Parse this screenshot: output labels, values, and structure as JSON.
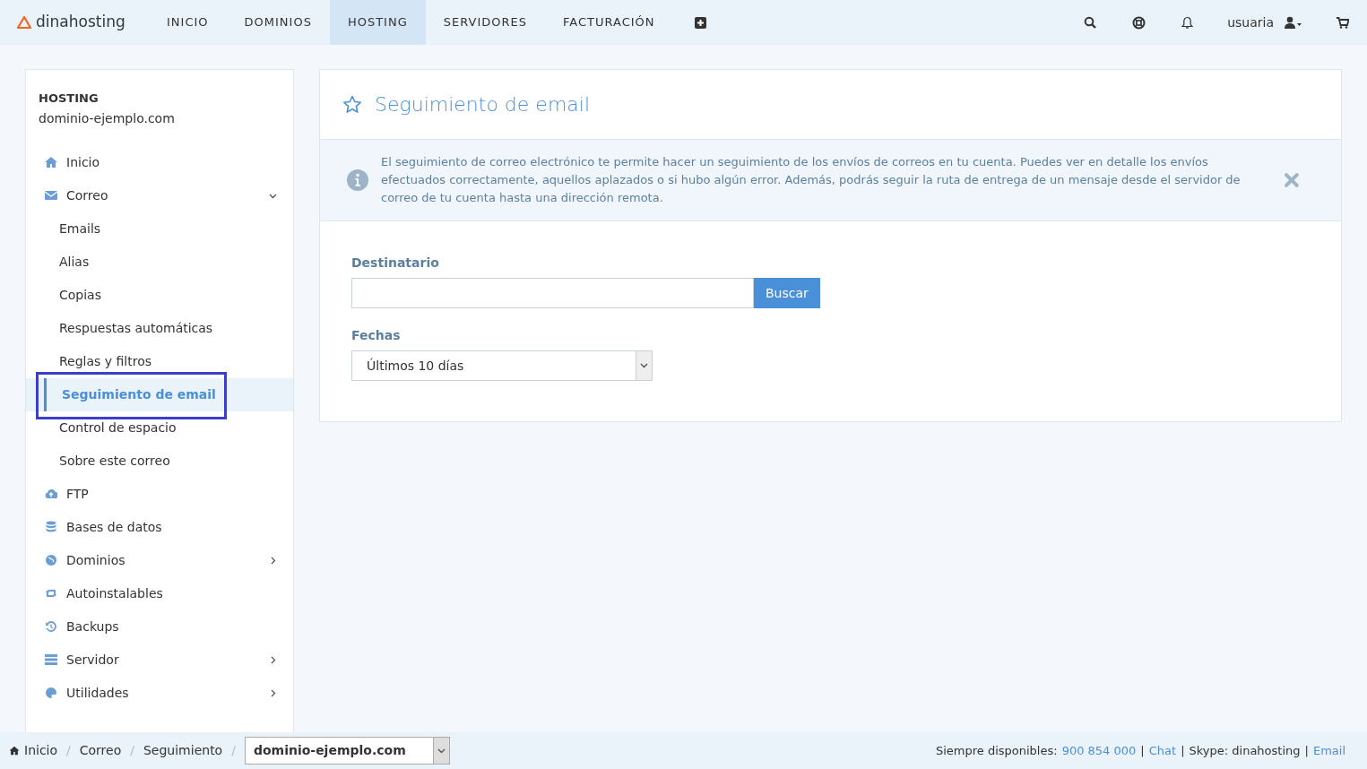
{
  "topbar": {
    "logo": "dinahosting",
    "nav": [
      {
        "label": "INICIO",
        "selected": false
      },
      {
        "label": "DOMINIOS",
        "selected": false
      },
      {
        "label": "HOSTING",
        "selected": true
      },
      {
        "label": "SERVIDORES",
        "selected": false
      },
      {
        "label": "FACTURACIÓN",
        "selected": false
      }
    ],
    "user": "usuaria"
  },
  "sidebar": {
    "section": "HOSTING",
    "domain": "dominio-ejemplo.com",
    "items": [
      {
        "kind": "main",
        "label": "Inicio",
        "selected": false
      },
      {
        "kind": "main",
        "label": "Correo",
        "selected": false,
        "expanded": true
      },
      {
        "kind": "sub",
        "label": "Emails",
        "selected": false
      },
      {
        "kind": "sub",
        "label": "Alias",
        "selected": false
      },
      {
        "kind": "sub",
        "label": "Copias",
        "selected": false
      },
      {
        "kind": "sub",
        "label": "Respuestas automáticas",
        "selected": false
      },
      {
        "kind": "sub",
        "label": "Reglas y filtros",
        "selected": false
      },
      {
        "kind": "sub",
        "label": "Seguimiento de email",
        "selected": true
      },
      {
        "kind": "sub",
        "label": "Control de espacio",
        "selected": false
      },
      {
        "kind": "sub",
        "label": "Sobre este correo",
        "selected": false
      },
      {
        "kind": "main",
        "label": "FTP",
        "selected": false
      },
      {
        "kind": "main",
        "label": "Bases de datos",
        "selected": false
      },
      {
        "kind": "main",
        "label": "Dominios",
        "selected": false,
        "expanded": false
      },
      {
        "kind": "main",
        "label": "Autoinstalables",
        "selected": false
      },
      {
        "kind": "main",
        "label": "Backups",
        "selected": false
      },
      {
        "kind": "main",
        "label": "Servidor",
        "selected": false,
        "expanded": false
      },
      {
        "kind": "main",
        "label": "Utilidades",
        "selected": false,
        "expanded": false
      }
    ]
  },
  "panel": {
    "title": "Seguimiento de email",
    "info": "El seguimiento de correo electrónico te permite hacer un seguimiento de los envíos de correos en tu cuenta. Puedes ver en detalle los envíos efectuados correctamente, aquellos aplazados o si hubo algún error. Además, podrás seguir la ruta de entrega de un mensaje desde el servidor de correo de tu cuenta hasta una dirección remota.",
    "recipient_label": "Destinatario",
    "search_button": "Buscar",
    "dates_label": "Fechas",
    "dates_value": "Últimos 10 días"
  },
  "footer": {
    "breadcrumb": [
      {
        "kind": "link",
        "text": "Inicio"
      },
      {
        "kind": "sep",
        "text": "/"
      },
      {
        "kind": "link",
        "text": "Correo"
      },
      {
        "kind": "sep",
        "text": "/"
      },
      {
        "kind": "link",
        "text": "Seguimiento"
      },
      {
        "kind": "sep",
        "text": "/"
      }
    ],
    "domain_select": "dominio-ejemplo.com",
    "contact": [
      {
        "kind": "text",
        "text": "Siempre disponibles:"
      },
      {
        "kind": "link",
        "text": "900 854 000"
      },
      {
        "kind": "sep",
        "text": "|"
      },
      {
        "kind": "link",
        "text": "Chat"
      },
      {
        "kind": "sep",
        "text": "|"
      },
      {
        "kind": "text",
        "text": "Skype: dinahosting"
      },
      {
        "kind": "sep",
        "text": "|"
      },
      {
        "kind": "link",
        "text": "Email"
      }
    ]
  }
}
